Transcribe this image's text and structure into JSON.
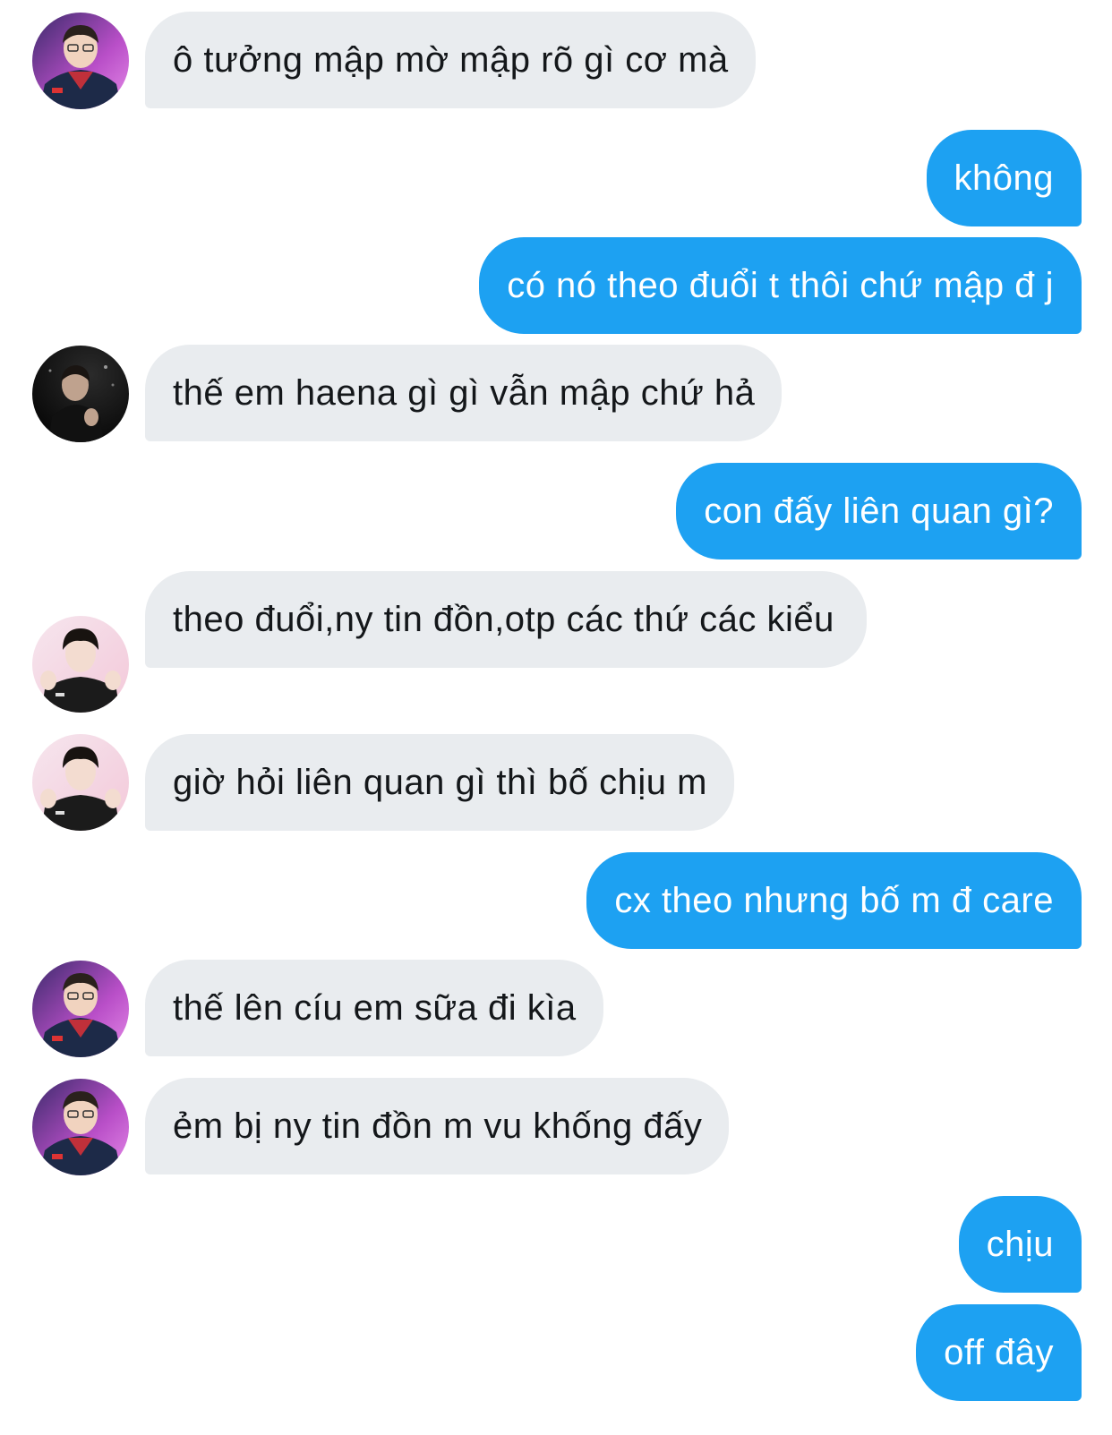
{
  "conversation": {
    "messages": [
      {
        "side": "in",
        "avatar": "player-glasses",
        "text": "ô tưởng mập mờ mập rõ gì cơ mà"
      },
      {
        "side": "out",
        "text": "không"
      },
      {
        "side": "out",
        "text": "có nó theo đuổi t thôi chứ mập đ j"
      },
      {
        "side": "in",
        "avatar": "dark-portrait",
        "text": "thế em haena gì gì vẫn mập chứ hả"
      },
      {
        "side": "out",
        "text": "con đấy liên quan gì?"
      },
      {
        "side": "in",
        "avatar": "player-pink",
        "text": "theo đuổi,ny tin đồn,otp các thứ các kiểu"
      },
      {
        "side": "in",
        "avatar": "player-pink",
        "text": "giờ hỏi liên quan gì thì bố chịu m"
      },
      {
        "side": "out",
        "text": "cx theo nhưng bố m đ care"
      },
      {
        "side": "in",
        "avatar": "player-glasses",
        "text": "thế lên cíu em sữa đi kìa"
      },
      {
        "side": "in",
        "avatar": "player-glasses",
        "text": "ẻm bị ny tin đồn m vu khống đấy"
      },
      {
        "side": "out",
        "text": "chịu"
      },
      {
        "side": "out",
        "text": "off đây"
      }
    ]
  },
  "colors": {
    "incoming_bubble": "#e9ecef",
    "outgoing_bubble": "#1da1f2",
    "incoming_text": "#14171a",
    "outgoing_text": "#ffffff"
  }
}
